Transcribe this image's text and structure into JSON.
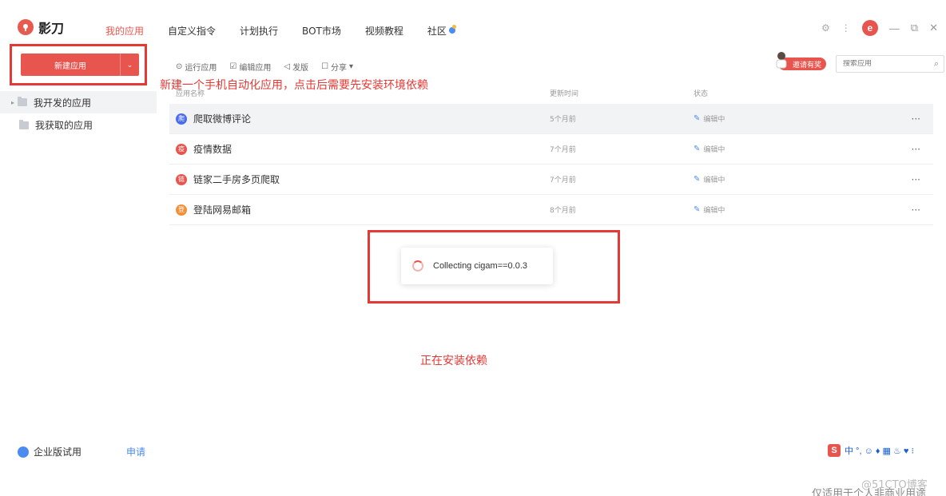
{
  "app": {
    "name": "影刀"
  },
  "nav": {
    "items": [
      {
        "label": "我的应用",
        "active": true
      },
      {
        "label": "自定义指令"
      },
      {
        "label": "计划执行"
      },
      {
        "label": "BOT市场"
      },
      {
        "label": "视频教程"
      },
      {
        "label": "社区"
      }
    ]
  },
  "top_right": {
    "avatar_letter": "e",
    "win_min": "—",
    "win_max": "⧉",
    "win_close": "✕"
  },
  "sidebar": {
    "new_app_label": "新建应用",
    "items": [
      {
        "label": "我开发的应用",
        "active": true
      },
      {
        "label": "我获取的应用"
      }
    ],
    "enterprise_label": "企业版试用",
    "apply_label": "申请"
  },
  "toolbar": {
    "run": "运行应用",
    "edit": "编辑应用",
    "publish": "发版",
    "share": "分享"
  },
  "invite": {
    "label": "邀请有奖"
  },
  "search": {
    "placeholder": "搜索应用"
  },
  "table": {
    "headers": {
      "name": "应用名称",
      "time": "更新时间",
      "status": "状态"
    },
    "rows": [
      {
        "name": "爬取微博评论",
        "icon_letter": "爬",
        "icon_color": "#4a6cf0",
        "time": "5个月前",
        "status": "编辑中"
      },
      {
        "name": "疫情数据",
        "icon_letter": "疫",
        "icon_color": "#e8554e",
        "time": "7个月前",
        "status": "编辑中"
      },
      {
        "name": "链家二手房多页爬取",
        "icon_letter": "链",
        "icon_color": "#e8554e",
        "time": "7个月前",
        "status": "编辑中"
      },
      {
        "name": "登陆网易邮箱",
        "icon_letter": "登",
        "icon_color": "#f0913a",
        "time": "8个月前",
        "status": "编辑中"
      }
    ]
  },
  "loading": {
    "text": "Collecting cigam==0.0.3"
  },
  "annotations": {
    "new_app_note": "新建一个手机自动化应用，点击后需要先安装环境依赖",
    "installing_note": "正在安装依赖"
  },
  "ime": {
    "s": "S",
    "text": "中 °, ☺ ♦ ▦ ♨ ♥ ⁝"
  },
  "watermark": {
    "line1": "@51CTO博客",
    "line2": "仅适用于个人非商业用途"
  },
  "colors": {
    "accent": "#e8554e",
    "annotation": "#e53935",
    "link": "#4a8cf0"
  }
}
